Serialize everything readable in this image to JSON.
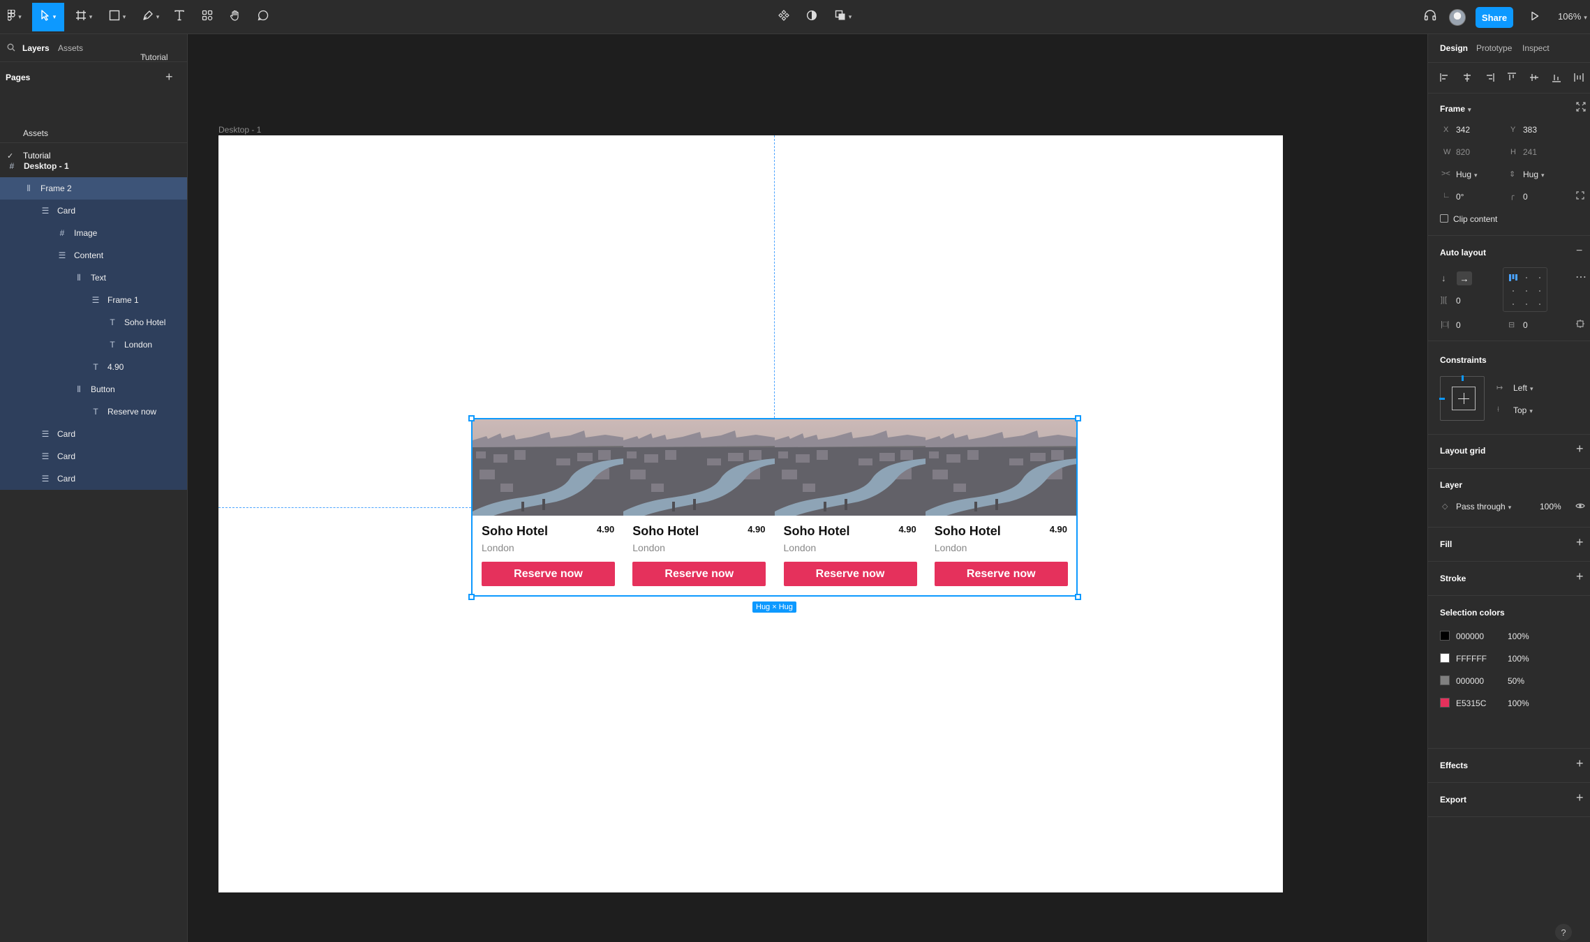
{
  "toolbar": {
    "zoom": "106%",
    "share_label": "Share"
  },
  "left_panel": {
    "tabs": [
      "Layers",
      "Assets"
    ],
    "page_switcher": "Tutorial",
    "pages_heading": "Pages",
    "pages": [
      {
        "label": "Assets",
        "current": false
      },
      {
        "label": "Tutorial",
        "current": true
      }
    ],
    "current_mark": "✓",
    "layers": [
      {
        "label": "Desktop - 1",
        "icon": "frame-icon",
        "glyph": "#",
        "indent": 0,
        "state": "normal"
      },
      {
        "label": "Frame 2",
        "icon": "auto-layout-horizontal-icon",
        "glyph": "⫴",
        "indent": 1,
        "state": "selected-head"
      },
      {
        "label": "Card",
        "icon": "auto-layout-vertical-icon",
        "glyph": "☰",
        "indent": 2,
        "state": "selected"
      },
      {
        "label": "Image",
        "icon": "frame-icon",
        "glyph": "#",
        "indent": 3,
        "state": "selected"
      },
      {
        "label": "Content",
        "icon": "auto-layout-vertical-icon",
        "glyph": "☰",
        "indent": 3,
        "state": "selected"
      },
      {
        "label": "Text",
        "icon": "auto-layout-horizontal-icon",
        "glyph": "⫴",
        "indent": 4,
        "state": "selected"
      },
      {
        "label": "Frame 1",
        "icon": "auto-layout-vertical-icon",
        "glyph": "☰",
        "indent": 5,
        "state": "selected"
      },
      {
        "label": "Soho Hotel",
        "icon": "text-icon",
        "glyph": "T",
        "indent": 6,
        "state": "selected"
      },
      {
        "label": "London",
        "icon": "text-icon",
        "glyph": "T",
        "indent": 6,
        "state": "selected"
      },
      {
        "label": "4.90",
        "icon": "text-icon",
        "glyph": "T",
        "indent": 5,
        "state": "selected"
      },
      {
        "label": "Button",
        "icon": "auto-layout-horizontal-icon",
        "glyph": "⫴",
        "indent": 4,
        "state": "selected"
      },
      {
        "label": "Reserve now",
        "icon": "text-icon",
        "glyph": "T",
        "indent": 5,
        "state": "selected"
      },
      {
        "label": "Card",
        "icon": "auto-layout-vertical-icon",
        "glyph": "☰",
        "indent": 2,
        "state": "selected"
      },
      {
        "label": "Card",
        "icon": "auto-layout-vertical-icon",
        "glyph": "☰",
        "indent": 2,
        "state": "selected"
      },
      {
        "label": "Card",
        "icon": "auto-layout-vertical-icon",
        "glyph": "☰",
        "indent": 2,
        "state": "selected"
      }
    ]
  },
  "canvas": {
    "frame_label": "Desktop - 1",
    "size_badge": "Hug × Hug",
    "cards": [
      {
        "title": "Soho Hotel",
        "city": "London",
        "rating": "4.90",
        "button": "Reserve now"
      },
      {
        "title": "Soho Hotel",
        "city": "London",
        "rating": "4.90",
        "button": "Reserve now"
      },
      {
        "title": "Soho Hotel",
        "city": "London",
        "rating": "4.90",
        "button": "Reserve now"
      },
      {
        "title": "Soho Hotel",
        "city": "London",
        "rating": "4.90",
        "button": "Reserve now"
      }
    ]
  },
  "right_panel": {
    "tabs": [
      "Design",
      "Prototype",
      "Inspect"
    ],
    "frame": {
      "heading": "Frame",
      "x_label": "X",
      "x": "342",
      "y_label": "Y",
      "y": "383",
      "w_label": "W",
      "w": "820",
      "h_label": "H",
      "h": "241",
      "hug_w": "Hug",
      "hug_h": "Hug",
      "rotation": "0°",
      "radius": "0",
      "clip_label": "Clip content"
    },
    "auto_layout": {
      "heading": "Auto layout",
      "spacing": "0",
      "padding_h": "0",
      "padding_v": "0"
    },
    "constraints": {
      "heading": "Constraints",
      "horizontal": "Left",
      "vertical": "Top"
    },
    "layout_grid": {
      "heading": "Layout grid"
    },
    "layer": {
      "heading": "Layer",
      "blend": "Pass through",
      "opacity": "100%"
    },
    "fill": {
      "heading": "Fill"
    },
    "stroke": {
      "heading": "Stroke"
    },
    "selection_colors": {
      "heading": "Selection colors",
      "colors": [
        {
          "hex": "000000",
          "opacity": "100%",
          "swatch": "#000000"
        },
        {
          "hex": "FFFFFF",
          "opacity": "100%",
          "swatch": "#FFFFFF"
        },
        {
          "hex": "000000",
          "opacity": "50%",
          "swatch": "#808080"
        },
        {
          "hex": "E5315C",
          "opacity": "100%",
          "swatch": "#E5315C"
        }
      ]
    },
    "effects": {
      "heading": "Effects"
    },
    "export": {
      "heading": "Export"
    }
  },
  "help_label": "?"
}
